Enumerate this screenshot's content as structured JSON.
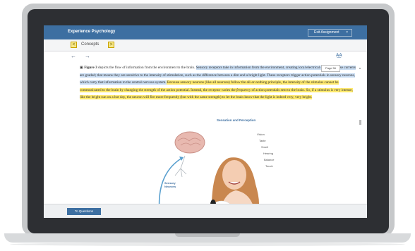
{
  "app": {
    "title": "Experience Psychology",
    "exit_label": "Exit Assignment",
    "exit_close": "×"
  },
  "concepts": {
    "prev": "<",
    "label": "Concepts",
    "next": ">"
  },
  "nav": {
    "back": "←",
    "forward": "→",
    "text_size": "A͟A"
  },
  "page_badge": "Page 56",
  "reading": {
    "figure_ref": "Figure 3",
    "s1": " depicts the flow of information from the environment to the brain. ",
    "s2": "Sensory receptors take in information from the environment, creating local electrical currents. These currents are graded; that means they are sensitive to the intensity of stimulation, such as the difference between a dim and a bright light. These receptors trigger action potentials in sensory neurons, which carry that information to the central nervous system.",
    "s3": " Because sensory neurons (like all neurons) follow the all-or-nothing principle, the intensity of the stimulus cannot be communicated to the brain by changing the strength of the action potential. Instead, the receptor varies the ",
    "s3_em": "frequency",
    "s4": " of action potentials sent to the brain. So, if a stimulus is very intense, like the bright sun on a hot day, the neuron will fire more frequently (but with the same strength) to let the brain know that the light is indeed very, very bright."
  },
  "figure": {
    "title": "Sensation and Perception",
    "senses": [
      "Vision",
      "Taste",
      "Smell",
      "Hearing",
      "Balance",
      "Touch"
    ],
    "sensory_label_1": "Sensory",
    "sensory_label_2": "Neurons",
    "action_label_1": "Action",
    "action_label_2": "potential"
  },
  "footer": {
    "to_questions": "To Questions"
  },
  "colors": {
    "appbar": "#3d6fa1",
    "highlight_blue": "#c8dcf2",
    "highlight_yellow": "#ffe96b"
  }
}
